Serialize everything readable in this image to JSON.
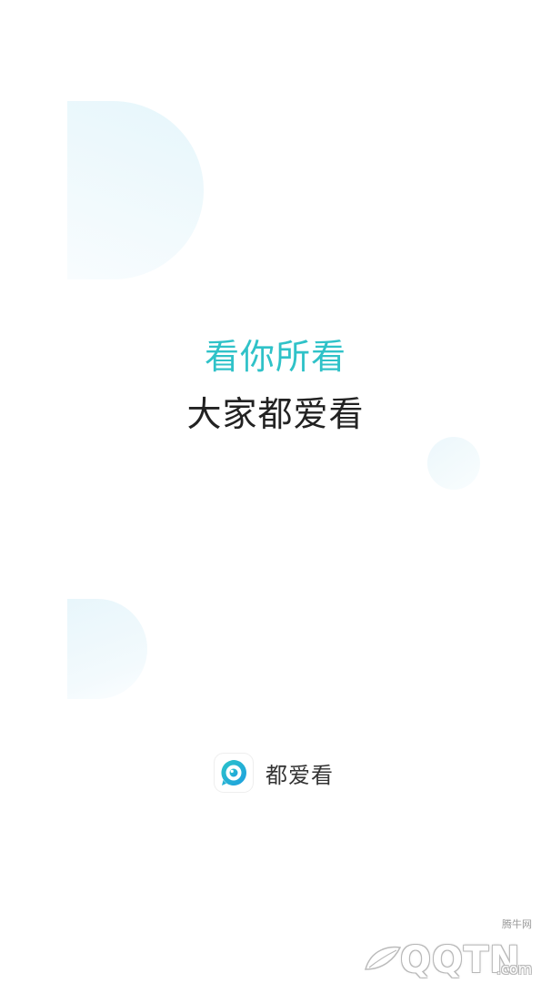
{
  "splash": {
    "slogan_primary": "看你所看",
    "slogan_secondary": "大家都爱看",
    "accent_color": "#2fc2c8",
    "text_color": "#222222"
  },
  "brand": {
    "name": "都爱看",
    "icon": "app-logo-icon"
  },
  "watermark": {
    "site_cn": "腾牛网",
    "logo_text": "QQTN",
    "domain_suffix": ".com"
  }
}
